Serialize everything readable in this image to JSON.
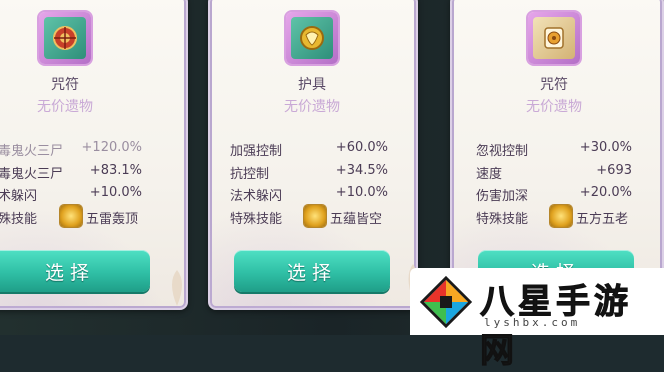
{
  "cards": [
    {
      "name": "咒符",
      "subtitle": "无价遗物",
      "stats": [
        {
          "label": "毒鬼火三尸",
          "value": "+120.0%"
        },
        {
          "label": "毒鬼火三尸",
          "value": "+83.1%"
        },
        {
          "label": "术躲闪",
          "value": "+10.0%"
        }
      ],
      "skill_label": "殊技能",
      "skill_name": "五雷轰顶",
      "button": "选择",
      "icon": "talisman-icon"
    },
    {
      "name": "护具",
      "subtitle": "无价遗物",
      "stats": [
        {
          "label": "加强控制",
          "value": "+60.0%"
        },
        {
          "label": "抗控制",
          "value": "+34.5%"
        },
        {
          "label": "法术躲闪",
          "value": "+10.0%"
        }
      ],
      "skill_label": "特殊技能",
      "skill_name": "五蕴皆空",
      "button": "选择",
      "icon": "armor-icon"
    },
    {
      "name": "咒符",
      "subtitle": "无价遗物",
      "stats": [
        {
          "label": "忽视控制",
          "value": "+30.0%"
        },
        {
          "label": "速度",
          "value": "+693"
        },
        {
          "label": "伤害加深",
          "value": "+20.0%"
        }
      ],
      "skill_label": "特殊技能",
      "skill_name": "五方五老",
      "button": "选择",
      "icon": "scroll-icon"
    }
  ],
  "watermark": {
    "title": "八星手游网",
    "url": "lyshbx.com"
  },
  "colors": {
    "button": "#2fbfa5",
    "card_bg": "#f7f4ee",
    "frame": "#d8a0e0",
    "subtitle": "#c9a9d6"
  }
}
